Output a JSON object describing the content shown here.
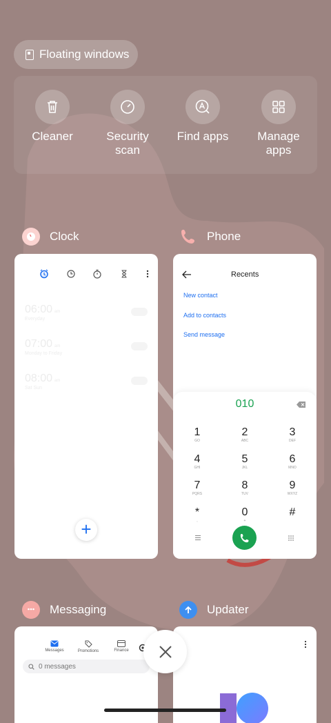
{
  "floating_windows": {
    "label": "Floating windows",
    "icon": "floating-window-icon"
  },
  "quick_actions": [
    {
      "label": "Cleaner",
      "icon": "trash-icon"
    },
    {
      "label": "Security\nscan",
      "icon": "speedometer-icon"
    },
    {
      "label": "Find apps",
      "icon": "find-apps-icon"
    },
    {
      "label": "Manage\napps",
      "icon": "grid-icon"
    }
  ],
  "apps": {
    "clock": {
      "name": "Clock",
      "alarms": [
        {
          "time": "06:00",
          "ampm": "am",
          "repeat": "Everyday"
        },
        {
          "time": "07:00",
          "ampm": "am",
          "repeat": "Monday to Friday"
        },
        {
          "time": "08:00",
          "ampm": "am",
          "repeat": "Sat Sun"
        }
      ],
      "fab": "+"
    },
    "phone": {
      "name": "Phone",
      "title": "Recents",
      "links": [
        "New contact",
        "Add to contacts",
        "Send message"
      ],
      "typed_number": "010",
      "keys": [
        {
          "d": "1",
          "l": "GO"
        },
        {
          "d": "2",
          "l": "ABC"
        },
        {
          "d": "3",
          "l": "DEF"
        },
        {
          "d": "4",
          "l": "GHI"
        },
        {
          "d": "5",
          "l": "JKL"
        },
        {
          "d": "6",
          "l": "MNO"
        },
        {
          "d": "7",
          "l": "PQRS"
        },
        {
          "d": "8",
          "l": "TUV"
        },
        {
          "d": "9",
          "l": "WXYZ"
        },
        {
          "d": "*",
          "l": ","
        },
        {
          "d": "0",
          "l": "+"
        },
        {
          "d": "#",
          "l": ""
        }
      ]
    },
    "messaging": {
      "name": "Messaging",
      "tabs": [
        "Messages",
        "Promotions",
        "Finance"
      ],
      "search_placeholder": "0 messages"
    },
    "updater": {
      "name": "Updater"
    }
  },
  "colors": {
    "accent_blue": "#1e6ff0",
    "call_green": "#1aa251",
    "background": "#9c8481"
  }
}
